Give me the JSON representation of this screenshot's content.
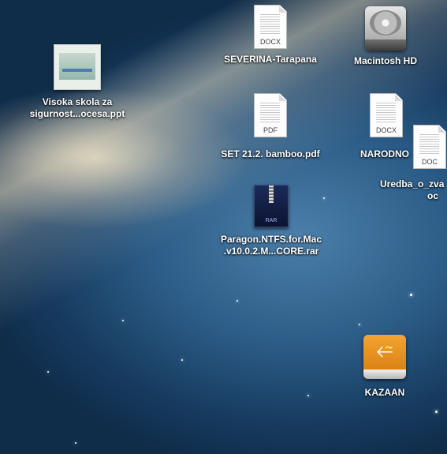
{
  "desktop": {
    "icons": [
      {
        "label_lines": [
          "Visoka skola za",
          "sigurnost...ocesa.ppt"
        ],
        "type_tag": ""
      },
      {
        "label_lines": [
          "SEVERINA-Tarapana"
        ],
        "type_tag": "DOCX"
      },
      {
        "label_lines": [
          "Macintosh HD"
        ],
        "type_tag": ""
      },
      {
        "label_lines": [
          "SET 21.2. bamboo.pdf"
        ],
        "type_tag": "PDF"
      },
      {
        "label_lines": [
          "NARODNO"
        ],
        "type_tag": "DOCX"
      },
      {
        "label_lines": [
          "Uredba_o_zva",
          "oc"
        ],
        "type_tag": "DOC"
      },
      {
        "label_lines": [
          "Paragon.NTFS.for.Mac",
          ".v10.0.2.M...CORE.rar"
        ],
        "type_tag": "RAR"
      },
      {
        "label_lines": [
          "KAZAAN"
        ],
        "type_tag": ""
      }
    ]
  },
  "colors": {
    "sky_dark": "#163a5e",
    "sky_light": "#4b7fa9",
    "usb_orange": "#f3a531"
  }
}
